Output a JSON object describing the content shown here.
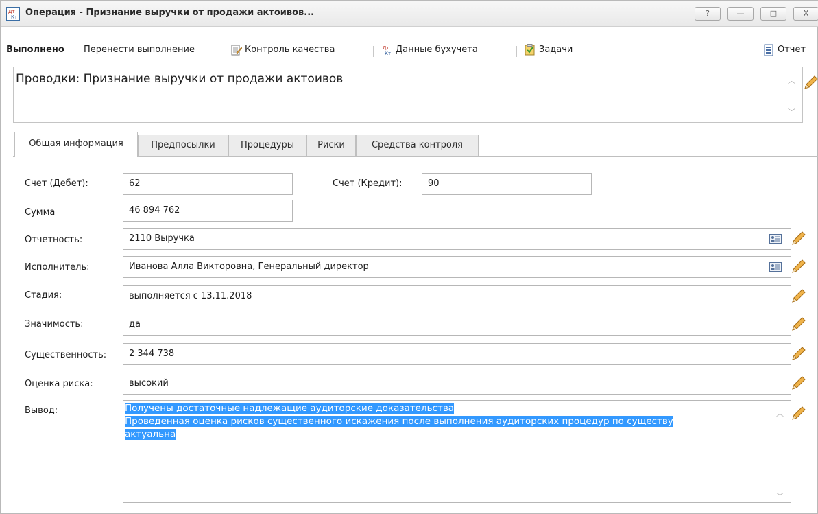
{
  "window": {
    "title": "Операция - Признание выручки от продажи актоивов...",
    "buttons": {
      "help": "?",
      "minimize": "—",
      "maximize": "□",
      "close": "X"
    }
  },
  "toolbar": {
    "done": "Выполнено",
    "reschedule": "Перенести выполнение",
    "quality_control": "Контроль качества",
    "accounting_data": "Данные бухучета",
    "tasks": "Задачи",
    "report": "Отчет"
  },
  "header": {
    "title": "Проводки: Признание выручки от продажи актоивов"
  },
  "tabs": [
    {
      "label": "Общая информация"
    },
    {
      "label": "Предпосылки"
    },
    {
      "label": "Процедуры"
    },
    {
      "label": "Риски"
    },
    {
      "label": "Средства контроля"
    }
  ],
  "form": {
    "debit_label": "Счет (Дебет):",
    "debit_value": "62",
    "credit_label": "Счет (Кредит):",
    "credit_value": "90",
    "sum_label": "Сумма",
    "sum_value": "46 894 762",
    "reporting_label": "Отчетность:",
    "reporting_value": "2110 Выручка",
    "executor_label": "Исполнитель:",
    "executor_value": "Иванова Алла Викторовна, Генеральный директор",
    "stage_label": "Стадия:",
    "stage_value": "выполняется с 13.11.2018",
    "significance_label": "Значимость:",
    "significance_value": "да",
    "materiality_label": "Существенность:",
    "materiality_value": "2 344 738",
    "risk_label": "Оценка риска:",
    "risk_value": "высокий",
    "conclusion_label": "Вывод:",
    "conclusion_lines": [
      "Получены достаточные надлежащие аудиторские доказательства",
      "Проведенная оценка рисков существенного искажения после выполнения аудиторских процедур по существу",
      "актуальна"
    ]
  },
  "colors": {
    "selection": "#3399ff",
    "pencil": "#e8a33a",
    "border": "#b7b7b7"
  }
}
